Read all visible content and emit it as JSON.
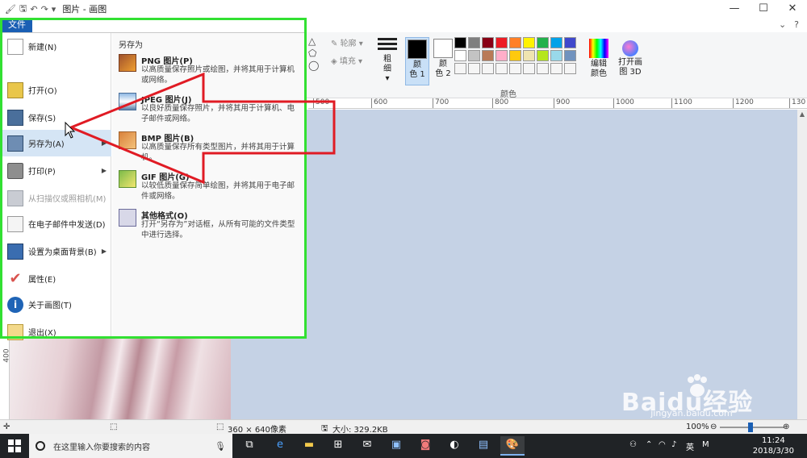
{
  "window": {
    "title": "图片 - 画图",
    "controls": [
      "—",
      "☐",
      "✕"
    ]
  },
  "ribbon": {
    "file_tab": "文件",
    "right_icons": [
      "⌄",
      "?"
    ],
    "outline_label": "轮廓",
    "fill_label": "填充",
    "size_label": "粗\n细",
    "size_caret": "▾",
    "color1_label": "颜\n色 1",
    "color2_label": "颜\n色 2",
    "colors_group_label": "颜色",
    "edit_colors_label": "编辑\n颜色",
    "paint3d_label": "打开画\n图 3D",
    "color1": "#000000",
    "color2": "#ffffff",
    "palette": [
      "#000000",
      "#7f7f7f",
      "#880015",
      "#ed1c24",
      "#ff7f27",
      "#fff200",
      "#22b14c",
      "#00a2e8",
      "#3f48cc",
      "#ffffff",
      "#c3c3c3",
      "#b97a57",
      "#ffaec9",
      "#ffc90e",
      "#efe4b0",
      "#b5e61d",
      "#99d9ea",
      "#7092be",
      "#f5f5f5",
      "#f5f5f5",
      "#f5f5f5",
      "#f5f5f5",
      "#f5f5f5",
      "#f5f5f5",
      "#f5f5f5",
      "#f5f5f5",
      "#f5f5f5"
    ]
  },
  "ruler": {
    "ticks": [
      "500",
      "600",
      "700",
      "800",
      "900",
      "1000",
      "1100",
      "1200",
      "130"
    ],
    "vertical": "400"
  },
  "file_menu": {
    "items": [
      {
        "label": "新建(N)",
        "icon": "new-file-icon",
        "submenu": false,
        "disabled": false
      },
      {
        "label": "打开(O)",
        "icon": "open-folder-icon",
        "submenu": false,
        "disabled": false
      },
      {
        "label": "保存(S)",
        "icon": "save-disk-icon",
        "submenu": false,
        "disabled": false
      },
      {
        "label": "另存为(A)",
        "icon": "save-as-icon",
        "submenu": true,
        "disabled": false
      },
      {
        "label": "打印(P)",
        "icon": "printer-icon",
        "submenu": true,
        "disabled": false
      },
      {
        "label": "从扫描仪或照相机(M)",
        "icon": "scanner-icon",
        "submenu": false,
        "disabled": true
      },
      {
        "label": "在电子邮件中发送(D)",
        "icon": "email-icon",
        "submenu": false,
        "disabled": false
      },
      {
        "label": "设置为桌面背景(B)",
        "icon": "desktop-background-icon",
        "submenu": true,
        "disabled": false
      },
      {
        "label": "属性(E)",
        "icon": "checkmark-icon",
        "submenu": false,
        "disabled": false
      },
      {
        "label": "关于画图(T)",
        "icon": "info-icon",
        "submenu": false,
        "disabled": false
      },
      {
        "label": "退出(X)",
        "icon": "exit-icon",
        "submenu": false,
        "disabled": false
      }
    ],
    "saveas": {
      "title": "另存为",
      "options": [
        {
          "title": "PNG 图片(P)",
          "desc": "以高质量保存照片或绘图，并将其用于计算机或网络。",
          "icon": "png-image-icon"
        },
        {
          "title": "JPEG 图片(J)",
          "desc": "以良好质量保存照片，并将其用于计算机、电子邮件或网络。",
          "icon": "jpeg-image-icon"
        },
        {
          "title": "BMP 图片(B)",
          "desc": "以高质量保存所有类型图片，并将其用于计算机。",
          "icon": "bmp-image-icon"
        },
        {
          "title": "GIF 图片(G)",
          "desc": "以较低质量保存简单绘图，并将其用于电子邮件或网络。",
          "icon": "gif-image-icon"
        },
        {
          "title": "其他格式(O)",
          "desc": "打开“另存为”对话框，从所有可能的文件类型中进行选择。",
          "icon": "other-formats-icon"
        }
      ]
    }
  },
  "statusbar": {
    "dimensions": "360 × 640像素",
    "size": "大小: 329.2KB",
    "zoom": "100%",
    "zoom_level": 0.48
  },
  "watermark": {
    "brand": "Baidu经验",
    "url": "jingyan.baidu.com"
  },
  "taskbar": {
    "search_placeholder": "在这里输入你要搜索的内容",
    "input_lang": "英",
    "ime": "M",
    "time": "11:24",
    "date": "2018/3/30"
  },
  "colors": {
    "accent": "#1a5fb4",
    "highlight_box": "#32e032",
    "arrow": "#e01b24"
  }
}
